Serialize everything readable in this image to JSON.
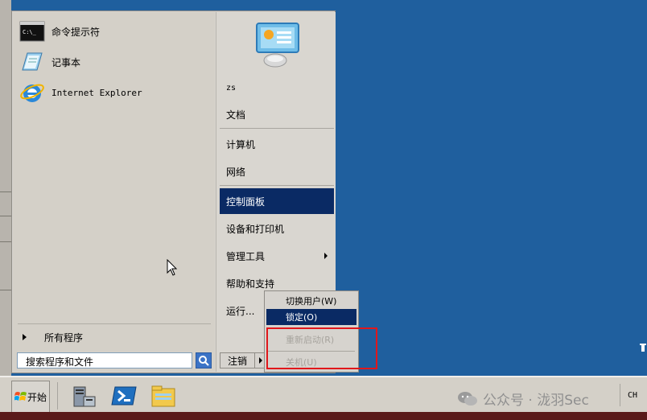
{
  "start_menu": {
    "pinned": [
      {
        "label": "命令提示符",
        "icon": "cmd-icon"
      },
      {
        "label": "记事本",
        "icon": "notepad-icon"
      },
      {
        "label": "Internet Explorer",
        "icon": "ie-icon"
      }
    ],
    "all_programs_label": "所有程序",
    "search_placeholder": "搜索程序和文件",
    "right_items": [
      {
        "label": "zs"
      },
      {
        "label": "文档"
      },
      {
        "label": "计算机"
      },
      {
        "label": "网络"
      },
      {
        "label": "控制面板"
      },
      {
        "label": "设备和打印机"
      },
      {
        "label": "管理工具"
      },
      {
        "label": "帮助和支持"
      },
      {
        "label": "运行..."
      }
    ],
    "logoff_label": "注销"
  },
  "power_menu": {
    "switch_user": "切换用户(W)",
    "lock": "锁定(O)",
    "restart": "重新启动(R)",
    "shutdown": "关机(U)"
  },
  "taskbar": {
    "start_label": "开始",
    "tray_lang": "CH",
    "watermark": "公众号 · 泷羽Sec"
  },
  "colors": {
    "desktop": "#1f5f9e",
    "highlight": "#0a2a64",
    "annotation": "#e1171b"
  }
}
